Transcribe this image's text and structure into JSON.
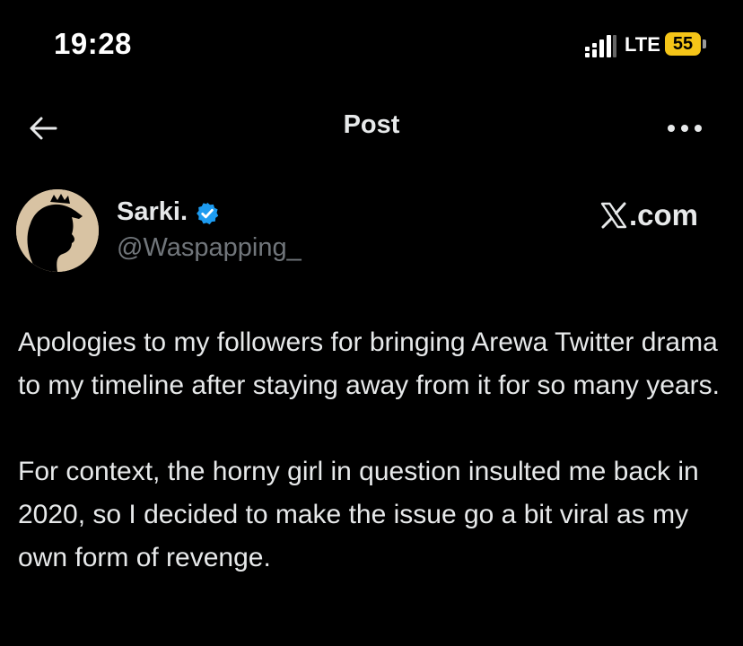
{
  "status_bar": {
    "time": "19:28",
    "network": "LTE",
    "battery_level": "55",
    "battery_color": "#f5c518"
  },
  "nav": {
    "title": "Post",
    "back_icon": "arrow-left-icon",
    "more_icon": "more-horizontal-icon"
  },
  "author": {
    "display_name": "Sarki.",
    "handle": "@Waspapping_",
    "verified": true,
    "verified_color": "#1d9bf0"
  },
  "watermark": {
    "text": ".com",
    "icon": "x-logo-icon"
  },
  "tweet": {
    "paragraphs": [
      "Apologies to my followers for bringing Arewa Twitter drama to my timeline after staying away from it for so many years.",
      "For context, the horny girl in question insulted me back in 2020, so I decided to make the issue go a bit viral as my own form of revenge."
    ]
  },
  "colors": {
    "background": "#000000",
    "text_primary": "#e7e9ea",
    "text_secondary": "#71767b"
  }
}
